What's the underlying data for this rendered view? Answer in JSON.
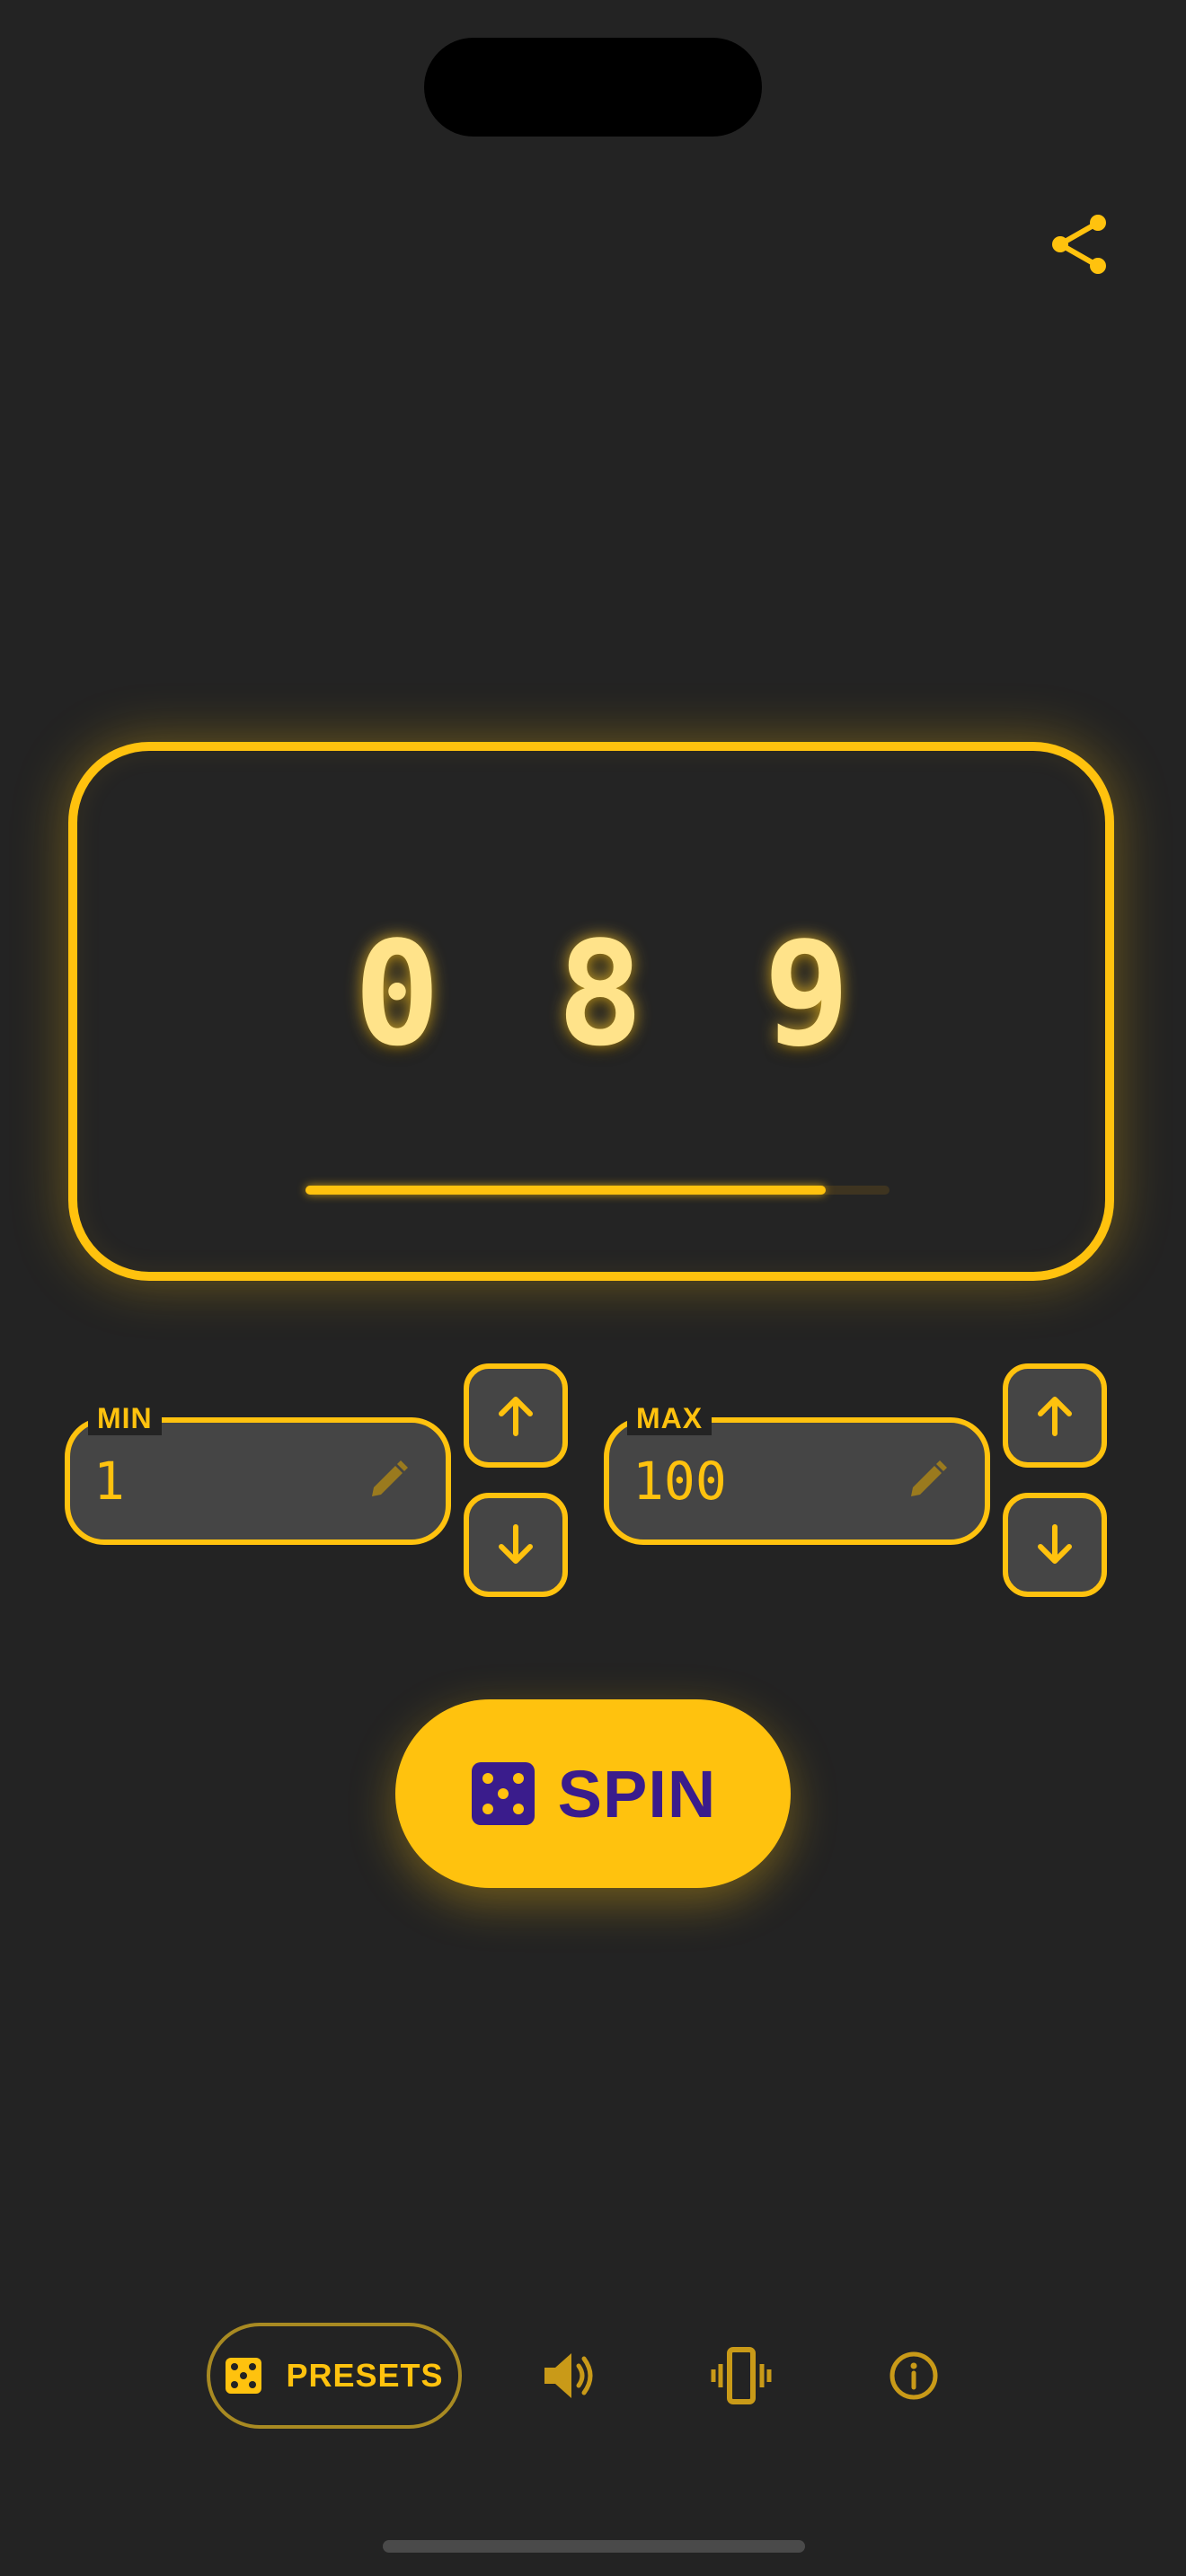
{
  "colors": {
    "accent": "#FFC20E",
    "background": "#232323",
    "field_bg": "#454545",
    "digit": "#FFE38A",
    "spin_text": "#3A1C8C"
  },
  "header": {
    "share_icon": "share-icon"
  },
  "display": {
    "digits": [
      "0",
      "8",
      "9"
    ],
    "progress": 0.89
  },
  "min_field": {
    "label": "MIN",
    "value": "1",
    "edit_icon": "pencil-icon"
  },
  "max_field": {
    "label": "MAX",
    "value": "100",
    "edit_icon": "pencil-icon"
  },
  "steppers": {
    "up_icon": "arrow-up-icon",
    "down_icon": "arrow-down-icon"
  },
  "spin_button": {
    "label": "SPIN",
    "icon": "dice-icon"
  },
  "bottom_bar": {
    "presets_label": "PRESETS",
    "presets_icon": "dice-icon",
    "sound_icon": "speaker-icon",
    "vibration_icon": "vibration-icon",
    "info_icon": "info-icon"
  }
}
